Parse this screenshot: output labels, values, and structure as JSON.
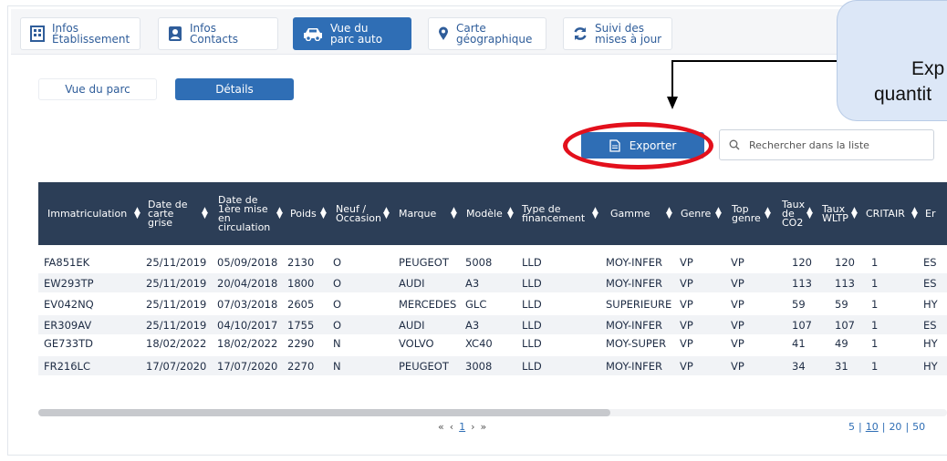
{
  "tabs": [
    {
      "label": "Infos\nÉtablissement",
      "icon": "building-icon",
      "active": false
    },
    {
      "label": "Infos\nContacts",
      "icon": "contact-card-icon",
      "active": false
    },
    {
      "label": "Vue du\nparc auto",
      "icon": "car-icon",
      "active": true
    },
    {
      "label": "Carte\ngéographique",
      "icon": "map-pin-icon",
      "active": false
    },
    {
      "label": "Suivi des\nmises à jour",
      "icon": "refresh-icon",
      "active": false
    }
  ],
  "subtabs": {
    "overview": "Vue du parc",
    "details": "Détails"
  },
  "callout": {
    "line1": "Exp",
    "line2": "quantit"
  },
  "toolbar": {
    "export_label": "Exporter",
    "search_placeholder": "Rechercher dans la liste"
  },
  "table": {
    "columns": [
      "Immatriculation",
      "Date de\ncarte\ngrise",
      "Date de\n1ère mise\nen\ncirculation",
      "Poids",
      "Neuf /\nOccasion",
      "Marque",
      "Modèle",
      "Type de\nfinancement",
      "Gamme",
      "Genre",
      "Top\ngenre",
      "Taux\nde\nCO2",
      "Taux\nWLTP",
      "CRITAIR",
      "Er"
    ],
    "rows": [
      [
        "FA851EK",
        "25/11/2019",
        "05/09/2018",
        "2130",
        "O",
        "PEUGEOT",
        "5008",
        "LLD",
        "MOY-INFER",
        "VP",
        "VP",
        "120",
        "120",
        "1",
        "ES"
      ],
      [
        "EW293TP",
        "25/11/2019",
        "20/04/2018",
        "1800",
        "O",
        "AUDI",
        "A3",
        "LLD",
        "MOY-INFER",
        "VP",
        "VP",
        "113",
        "113",
        "1",
        "ES"
      ],
      [
        "EV042NQ",
        "25/11/2019",
        "07/03/2018",
        "2605",
        "O",
        "MERCEDES",
        "GLC",
        "LLD",
        "SUPERIEURE",
        "VP",
        "VP",
        "59",
        "59",
        "1",
        "HY"
      ],
      [
        "ER309AV",
        "25/11/2019",
        "04/10/2017",
        "1755",
        "O",
        "AUDI",
        "A3",
        "LLD",
        "MOY-INFER",
        "VP",
        "VP",
        "107",
        "107",
        "1",
        "ES"
      ],
      [
        "GE733TD",
        "18/02/2022",
        "18/02/2022",
        "2290",
        "N",
        "VOLVO",
        "XC40",
        "LLD",
        "MOY-SUPER",
        "VP",
        "VP",
        "41",
        "49",
        "1",
        "HY"
      ],
      [
        "FR216LC",
        "17/07/2020",
        "17/07/2020",
        "2270",
        "N",
        "PEUGEOT",
        "3008",
        "LLD",
        "MOY-INFER",
        "VP",
        "VP",
        "34",
        "31",
        "1",
        "HY"
      ]
    ]
  },
  "pagination": {
    "first": "«",
    "prev": "‹",
    "current": "1",
    "next": "›",
    "last": "»"
  },
  "page_size": {
    "options": [
      "5",
      "10",
      "20",
      "50"
    ],
    "selected": "10",
    "separator": "|"
  },
  "colors": {
    "primary": "#2f6eb5",
    "header_bg": "#2c3e57",
    "highlight_ring": "#e3101c",
    "callout_bg": "#dce7f7"
  }
}
